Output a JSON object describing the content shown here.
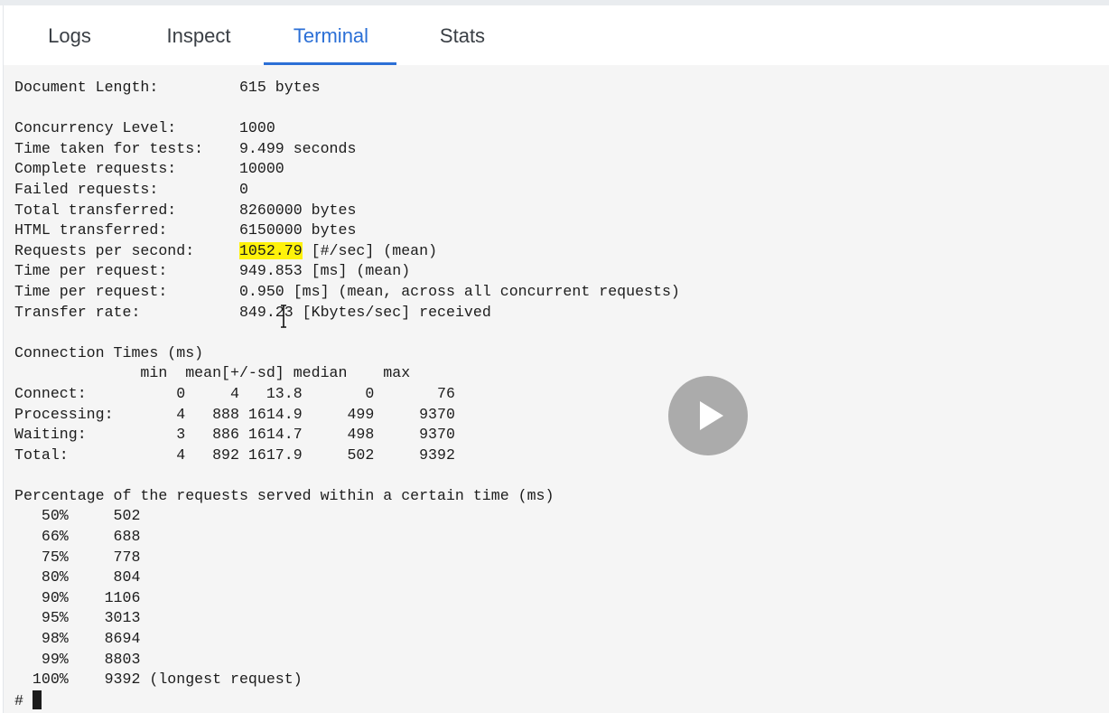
{
  "tabs": [
    {
      "label": "Logs",
      "active": false
    },
    {
      "label": "Inspect",
      "active": false
    },
    {
      "label": "Terminal",
      "active": true
    },
    {
      "label": "Stats",
      "active": false
    }
  ],
  "colors": {
    "accent": "#2b6fd6",
    "highlight": "#fff20a",
    "terminal_bg": "#f5f5f5"
  },
  "terminal": {
    "summary": [
      {
        "label": "Document Length:",
        "value": "615 bytes"
      },
      {
        "label": "",
        "value": ""
      },
      {
        "label": "Concurrency Level:",
        "value": "1000"
      },
      {
        "label": "Time taken for tests:",
        "value": "9.499 seconds"
      },
      {
        "label": "Complete requests:",
        "value": "10000"
      },
      {
        "label": "Failed requests:",
        "value": "0"
      },
      {
        "label": "Total transferred:",
        "value": "8260000 bytes"
      },
      {
        "label": "HTML transferred:",
        "value": "6150000 bytes"
      }
    ],
    "rps": {
      "label": "Requests per second:",
      "value": "1052.79",
      "suffix": " [#/sec] (mean)"
    },
    "summary2": [
      {
        "label": "Time per request:",
        "value": "949.853 [ms] (mean)"
      },
      {
        "label": "Time per request:",
        "value": "0.950 [ms] (mean, across all concurrent requests)"
      },
      {
        "label": "Transfer rate:",
        "value": "849.23 [Kbytes/sec] received"
      }
    ],
    "connection_title": "Connection Times (ms)",
    "connection_header": [
      "min",
      "mean[+/-sd]",
      "median",
      "max"
    ],
    "connection_rows": [
      {
        "label": "Connect:",
        "min": "0",
        "mean": "4",
        "sd": "13.8",
        "median": "0",
        "max": "76"
      },
      {
        "label": "Processing:",
        "min": "4",
        "mean": "888",
        "sd": "1614.9",
        "median": "499",
        "max": "9370"
      },
      {
        "label": "Waiting:",
        "min": "3",
        "mean": "886",
        "sd": "1614.7",
        "median": "498",
        "max": "9370"
      },
      {
        "label": "Total:",
        "min": "4",
        "mean": "892",
        "sd": "1617.9",
        "median": "502",
        "max": "9392"
      }
    ],
    "percentage_title": "Percentage of the requests served within a certain time (ms)",
    "percentiles": [
      {
        "pct": "50%",
        "ms": "502",
        "note": ""
      },
      {
        "pct": "66%",
        "ms": "688",
        "note": ""
      },
      {
        "pct": "75%",
        "ms": "778",
        "note": ""
      },
      {
        "pct": "80%",
        "ms": "804",
        "note": ""
      },
      {
        "pct": "90%",
        "ms": "1106",
        "note": ""
      },
      {
        "pct": "95%",
        "ms": "3013",
        "note": ""
      },
      {
        "pct": "98%",
        "ms": "8694",
        "note": ""
      },
      {
        "pct": "99%",
        "ms": "8803",
        "note": ""
      },
      {
        "pct": "100%",
        "ms": "9392",
        "note": "(longest request)"
      }
    ],
    "prompt": "#"
  }
}
